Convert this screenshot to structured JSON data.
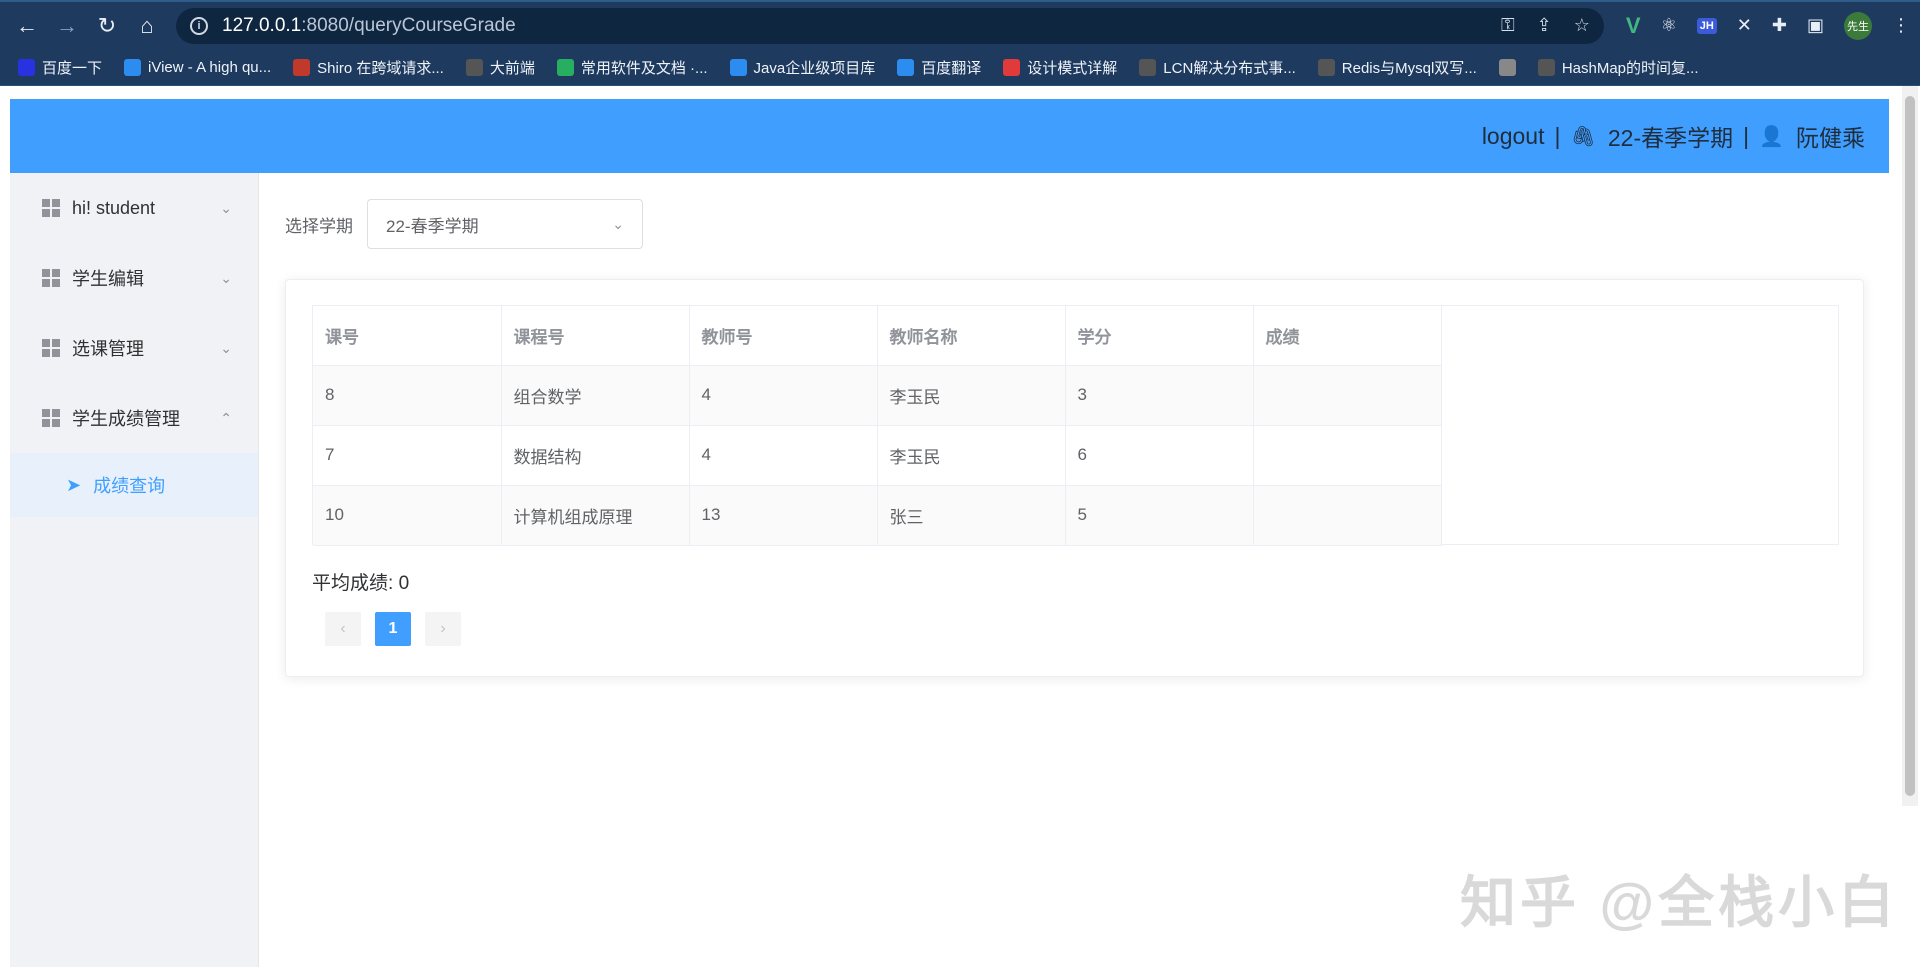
{
  "browser": {
    "url_host": "127.0.0.1",
    "url_path": ":8080/queryCourseGrade",
    "profile_label": "先生",
    "bookmarks": [
      {
        "label": "百度一下",
        "color": "#2932e1",
        "icon": "paw-icon"
      },
      {
        "label": "iView - A high qu...",
        "color": "#2d8cf0",
        "icon": "drop-icon"
      },
      {
        "label": "Shiro 在跨域请求...",
        "color": "#c0392b",
        "icon": "hat-icon"
      },
      {
        "label": "大前端",
        "color": "#555555",
        "icon": "book-icon"
      },
      {
        "label": "常用软件及文档 ·...",
        "color": "#27ae60",
        "icon": "leaf-icon"
      },
      {
        "label": "Java企业级项目库",
        "color": "#2d8cf0",
        "icon": "swirl-icon"
      },
      {
        "label": "百度翻译",
        "color": "#2d8cf0",
        "icon": "translate-icon"
      },
      {
        "label": "设计模式详解",
        "color": "#e03a3a",
        "icon": "c-icon"
      },
      {
        "label": "LCN解决分布式事...",
        "color": "#555555",
        "icon": "github-icon"
      },
      {
        "label": "Redis与Mysql双写...",
        "color": "#555555",
        "icon": "github-icon"
      },
      {
        "label": "",
        "color": "#888888",
        "icon": "globe-icon"
      },
      {
        "label": "HashMap的时间复...",
        "color": "#555555",
        "icon": "github-icon"
      }
    ]
  },
  "header": {
    "logout": "logout",
    "sep": "|",
    "semester": "22-春季学期",
    "user": "阮健乘"
  },
  "sidebar": {
    "items": [
      {
        "label": "hi! student",
        "chevron": "⌄"
      },
      {
        "label": "学生编辑",
        "chevron": "⌄"
      },
      {
        "label": "选课管理",
        "chevron": "⌄"
      },
      {
        "label": "学生成绩管理",
        "chevron": "⌃"
      }
    ],
    "sub_item": "成绩查询"
  },
  "filter": {
    "label": "选择学期",
    "value": "22-春季学期"
  },
  "table": {
    "columns": [
      "课号",
      "课程号",
      "教师号",
      "教师名称",
      "学分",
      "成绩"
    ],
    "rows": [
      [
        "8",
        "组合数学",
        "4",
        "李玉民",
        "3",
        ""
      ],
      [
        "7",
        "数据结构",
        "4",
        "李玉民",
        "6",
        ""
      ],
      [
        "10",
        "计算机组成原理",
        "13",
        "张三",
        "5",
        ""
      ]
    ]
  },
  "summary": {
    "avg_label": "平均成绩:",
    "avg_value": "0"
  },
  "pager": {
    "prev": "‹",
    "current": "1",
    "next": "›"
  },
  "watermark": "知乎 @全栈小白",
  "colors": {
    "accent": "#409eff",
    "browser": "#1e3a5f"
  }
}
